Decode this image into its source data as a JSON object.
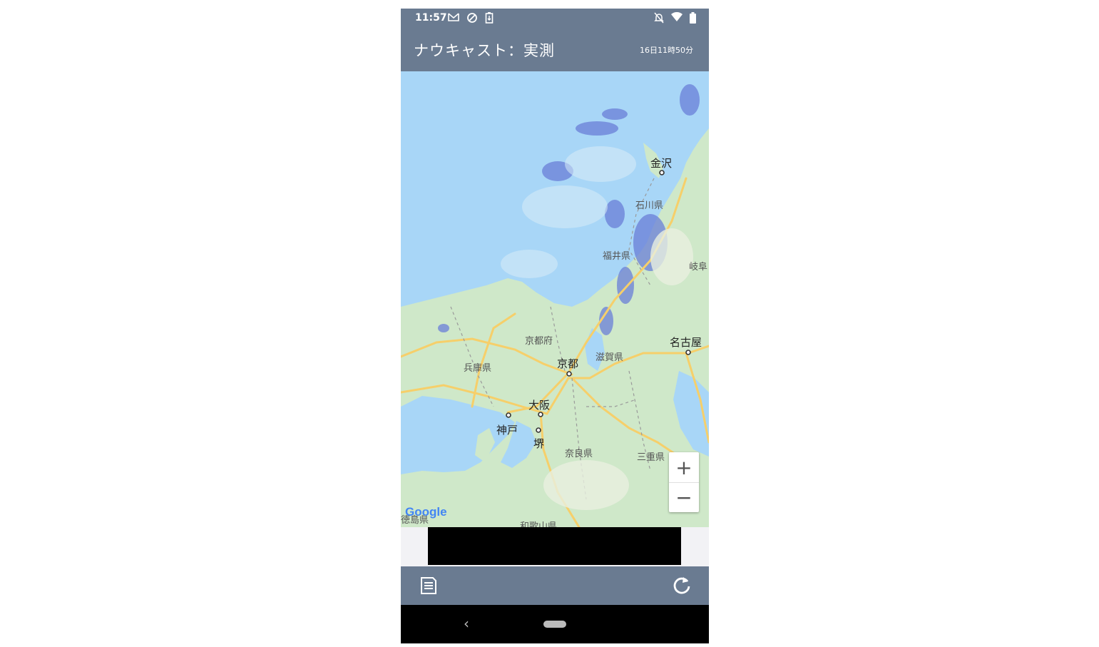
{
  "status_bar": {
    "time": "11:57",
    "left_icons": [
      "mail-icon",
      "sync-icon",
      "battery-saver-icon"
    ],
    "right_icons": [
      "notifications-off-icon",
      "wifi-icon",
      "battery-icon"
    ]
  },
  "app_bar": {
    "title": "ナウキャスト：実測",
    "observed_time": "16日11時50分"
  },
  "map": {
    "labels": {
      "kanazawa": "金沢",
      "ishikawa": "石川県",
      "fukui": "福井県",
      "gifu": "岐阜",
      "kyotofu": "京都府",
      "nagoya": "名古屋",
      "hyogo": "兵庫県",
      "kyoto": "京都",
      "shiga": "滋賀県",
      "osaka": "大阪",
      "kobe": "神戸",
      "sakai": "堺",
      "nara": "奈良県",
      "mie": "三重県",
      "tokushima": "徳島県",
      "wakayama": "和歌山県"
    },
    "zoom_in": "+",
    "zoom_out": "−",
    "attribution": "Google",
    "colors": {
      "sea": "#a8d6f7",
      "land": "#cfe8c9",
      "road": "#f6cf6a",
      "rain": "#6a7fd8"
    }
  },
  "bottom_bar": {
    "left_icon": "list-icon",
    "right_icon": "refresh-icon"
  },
  "nav_bar": {
    "back": "‹"
  }
}
